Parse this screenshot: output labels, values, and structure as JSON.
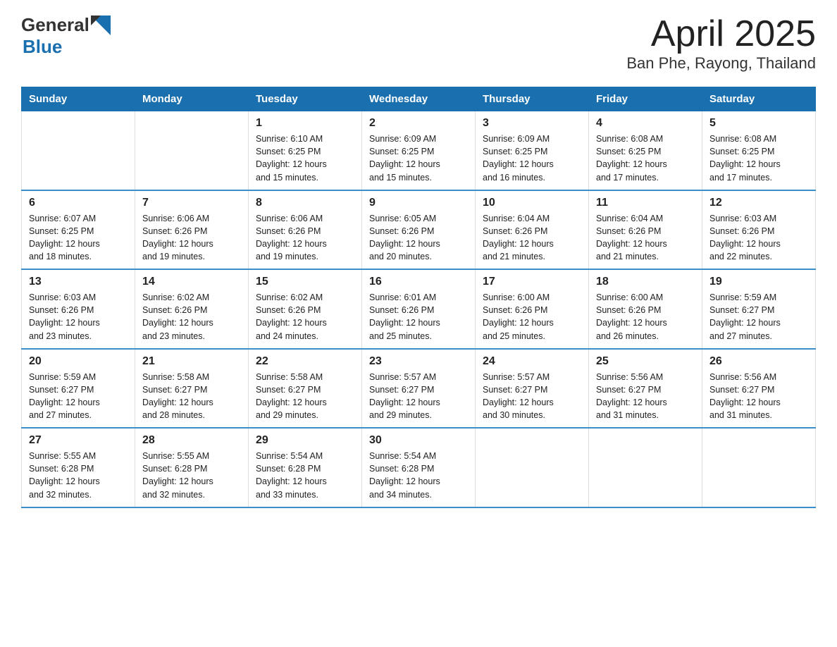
{
  "header": {
    "logo_general": "General",
    "logo_blue": "Blue",
    "title": "April 2025",
    "subtitle": "Ban Phe, Rayong, Thailand"
  },
  "days_of_week": [
    "Sunday",
    "Monday",
    "Tuesday",
    "Wednesday",
    "Thursday",
    "Friday",
    "Saturday"
  ],
  "weeks": [
    [
      {
        "day": "",
        "info": ""
      },
      {
        "day": "",
        "info": ""
      },
      {
        "day": "1",
        "info": "Sunrise: 6:10 AM\nSunset: 6:25 PM\nDaylight: 12 hours\nand 15 minutes."
      },
      {
        "day": "2",
        "info": "Sunrise: 6:09 AM\nSunset: 6:25 PM\nDaylight: 12 hours\nand 15 minutes."
      },
      {
        "day": "3",
        "info": "Sunrise: 6:09 AM\nSunset: 6:25 PM\nDaylight: 12 hours\nand 16 minutes."
      },
      {
        "day": "4",
        "info": "Sunrise: 6:08 AM\nSunset: 6:25 PM\nDaylight: 12 hours\nand 17 minutes."
      },
      {
        "day": "5",
        "info": "Sunrise: 6:08 AM\nSunset: 6:25 PM\nDaylight: 12 hours\nand 17 minutes."
      }
    ],
    [
      {
        "day": "6",
        "info": "Sunrise: 6:07 AM\nSunset: 6:25 PM\nDaylight: 12 hours\nand 18 minutes."
      },
      {
        "day": "7",
        "info": "Sunrise: 6:06 AM\nSunset: 6:26 PM\nDaylight: 12 hours\nand 19 minutes."
      },
      {
        "day": "8",
        "info": "Sunrise: 6:06 AM\nSunset: 6:26 PM\nDaylight: 12 hours\nand 19 minutes."
      },
      {
        "day": "9",
        "info": "Sunrise: 6:05 AM\nSunset: 6:26 PM\nDaylight: 12 hours\nand 20 minutes."
      },
      {
        "day": "10",
        "info": "Sunrise: 6:04 AM\nSunset: 6:26 PM\nDaylight: 12 hours\nand 21 minutes."
      },
      {
        "day": "11",
        "info": "Sunrise: 6:04 AM\nSunset: 6:26 PM\nDaylight: 12 hours\nand 21 minutes."
      },
      {
        "day": "12",
        "info": "Sunrise: 6:03 AM\nSunset: 6:26 PM\nDaylight: 12 hours\nand 22 minutes."
      }
    ],
    [
      {
        "day": "13",
        "info": "Sunrise: 6:03 AM\nSunset: 6:26 PM\nDaylight: 12 hours\nand 23 minutes."
      },
      {
        "day": "14",
        "info": "Sunrise: 6:02 AM\nSunset: 6:26 PM\nDaylight: 12 hours\nand 23 minutes."
      },
      {
        "day": "15",
        "info": "Sunrise: 6:02 AM\nSunset: 6:26 PM\nDaylight: 12 hours\nand 24 minutes."
      },
      {
        "day": "16",
        "info": "Sunrise: 6:01 AM\nSunset: 6:26 PM\nDaylight: 12 hours\nand 25 minutes."
      },
      {
        "day": "17",
        "info": "Sunrise: 6:00 AM\nSunset: 6:26 PM\nDaylight: 12 hours\nand 25 minutes."
      },
      {
        "day": "18",
        "info": "Sunrise: 6:00 AM\nSunset: 6:26 PM\nDaylight: 12 hours\nand 26 minutes."
      },
      {
        "day": "19",
        "info": "Sunrise: 5:59 AM\nSunset: 6:27 PM\nDaylight: 12 hours\nand 27 minutes."
      }
    ],
    [
      {
        "day": "20",
        "info": "Sunrise: 5:59 AM\nSunset: 6:27 PM\nDaylight: 12 hours\nand 27 minutes."
      },
      {
        "day": "21",
        "info": "Sunrise: 5:58 AM\nSunset: 6:27 PM\nDaylight: 12 hours\nand 28 minutes."
      },
      {
        "day": "22",
        "info": "Sunrise: 5:58 AM\nSunset: 6:27 PM\nDaylight: 12 hours\nand 29 minutes."
      },
      {
        "day": "23",
        "info": "Sunrise: 5:57 AM\nSunset: 6:27 PM\nDaylight: 12 hours\nand 29 minutes."
      },
      {
        "day": "24",
        "info": "Sunrise: 5:57 AM\nSunset: 6:27 PM\nDaylight: 12 hours\nand 30 minutes."
      },
      {
        "day": "25",
        "info": "Sunrise: 5:56 AM\nSunset: 6:27 PM\nDaylight: 12 hours\nand 31 minutes."
      },
      {
        "day": "26",
        "info": "Sunrise: 5:56 AM\nSunset: 6:27 PM\nDaylight: 12 hours\nand 31 minutes."
      }
    ],
    [
      {
        "day": "27",
        "info": "Sunrise: 5:55 AM\nSunset: 6:28 PM\nDaylight: 12 hours\nand 32 minutes."
      },
      {
        "day": "28",
        "info": "Sunrise: 5:55 AM\nSunset: 6:28 PM\nDaylight: 12 hours\nand 32 minutes."
      },
      {
        "day": "29",
        "info": "Sunrise: 5:54 AM\nSunset: 6:28 PM\nDaylight: 12 hours\nand 33 minutes."
      },
      {
        "day": "30",
        "info": "Sunrise: 5:54 AM\nSunset: 6:28 PM\nDaylight: 12 hours\nand 34 minutes."
      },
      {
        "day": "",
        "info": ""
      },
      {
        "day": "",
        "info": ""
      },
      {
        "day": "",
        "info": ""
      }
    ]
  ]
}
